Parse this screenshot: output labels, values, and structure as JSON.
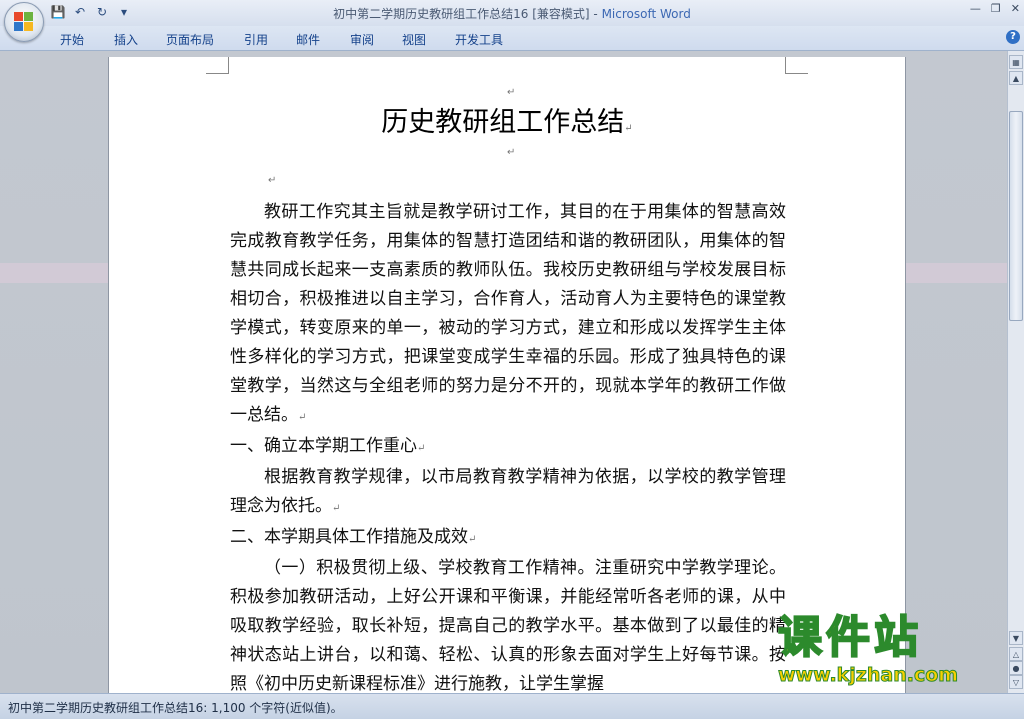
{
  "window": {
    "title": "初中第二学期历史教研组工作总结16 [兼容模式]",
    "app_name": "Microsoft Word",
    "separator": " - "
  },
  "ribbon": {
    "tabs": [
      "开始",
      "插入",
      "页面布局",
      "引用",
      "邮件",
      "审阅",
      "视图",
      "开发工具"
    ]
  },
  "document": {
    "title": "历史教研组工作总结",
    "paragraphs": [
      {
        "type": "indent",
        "text": "教研工作究其主旨就是教学研讨工作，其目的在于用集体的智慧高效完成教育教学任务，用集体的智慧打造团结和谐的教研团队，用集体的智慧共同成长起来一支高素质的教师队伍。我校历史教研组与学校发展目标相切合，积极推进以自主学习，合作育人，活动育人为主要特色的课堂教学模式，转变原来的单一，被动的学习方式，建立和形成以发挥学生主体性多样化的学习方式，把课堂变成学生幸福的乐园。形成了独具特色的课堂教学，当然这与全组老师的努力是分不开的，现就本学年的教研工作做一总结。"
      },
      {
        "type": "heading",
        "text": "一、确立本学期工作重心"
      },
      {
        "type": "indent",
        "text": "根据教育教学规律，以市局教育教学精神为依据，以学校的教学管理理念为依托。"
      },
      {
        "type": "heading",
        "text": "二、本学期具体工作措施及成效"
      },
      {
        "type": "indent",
        "text": "（一）积极贯彻上级、学校教育工作精神。注重研究中学教学理论。积极参加教研活动，上好公开课和平衡课，并能经常听各老师的课，从中吸取教学经验，取长补短，提高自己的教学水平。基本做到了以最佳的精神状态站上讲台，以和蔼、轻松、认真的形象去面对学生上好每节课。按照《初中历史新课程标准》进行施教，让学生掌握"
      }
    ]
  },
  "status": {
    "text": "初中第二学期历史教研组工作总结16: 1,100 个字符(近似值)。"
  },
  "watermark": {
    "cn": "课件站",
    "url": "www.kjzhan.com"
  },
  "icons": {
    "office": "office-button-icon",
    "save": "save-icon",
    "undo": "undo-icon",
    "redo": "redo-icon",
    "help": "help-icon"
  }
}
